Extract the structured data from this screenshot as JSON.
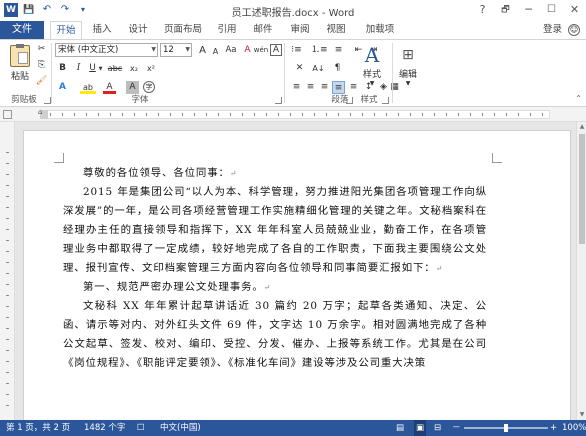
{
  "window": {
    "title": "员工述职报告.docx - Word",
    "controls": {
      "help": "?",
      "restore": "🗗",
      "minimize": "─",
      "maximize": "☐",
      "close": "✕"
    }
  },
  "quick_access": {
    "word_icon": "W",
    "save_icon": "💾",
    "undo_icon": "↶",
    "redo_icon": "↷",
    "customize_icon": "▾"
  },
  "tabs": {
    "file": "文件",
    "items": [
      "开始",
      "插入",
      "设计",
      "页面布局",
      "引用",
      "邮件",
      "审阅",
      "视图",
      "加载项"
    ],
    "active": "开始",
    "login": "登录"
  },
  "ribbon": {
    "clipboard": {
      "paste_label": "粘贴",
      "group_label": "剪贴板"
    },
    "font": {
      "font_name": "宋体 (中文正文)",
      "font_size": "12",
      "group_label": "字体",
      "btn_bold": "B",
      "btn_italic": "I",
      "btn_underline": "U",
      "btn_strike": "abc",
      "btn_sub": "x₂",
      "btn_sup": "x²",
      "btn_grow": "A",
      "btn_shrink": "A",
      "btn_aa": "Aa",
      "btn_clear": "A",
      "btn_wen": "wén",
      "btn_box": "A",
      "btn_effects": "A",
      "btn_highlight": "ab",
      "btn_color": "A",
      "btn_shade": "A",
      "btn_circle": "字"
    },
    "paragraph": {
      "group_label": "段落"
    },
    "styles": {
      "label": "样式",
      "group_label": "样式"
    },
    "editing": {
      "label": "编辑"
    }
  },
  "document": {
    "paragraphs": [
      "尊敬的各位领导、各位同事：",
      "2015 年是集团公司“以人为本、科学管理，努力推进阳光集团各项管理工作向纵深发展”的一年，是公司各项经营管理工作实施精细化管理的关键之年。文秘档案科在经理办主任的直接领导和指挥下，XX 年年科室人员兢兢业业，勤奋工作，在各项管理业务中都取得了一定成绩，较好地完成了各自的工作职责，下面我主要围绕公文处理、报刊宣传、文印档案管理三方面内容向各位领导和同事简要汇报如下：",
      "第一、规范严密办理公文处理事务。",
      "文秘科 XX 年年累计起草讲话近 30 篇约 20 万字；起草各类通知、决定、公函、请示等对内、对外红头文件 69 件，文字达 10 万余字。相对圆满地完成了各种公文起草、签发、校对、编印、受控、分发、催办、上报等系统工作。尤其是在公司《岗位规程》、《职能评定要领》、《标准化车间》建设等涉及公司重大决策"
    ],
    "para_mark": "↵"
  },
  "statusbar": {
    "page": "第 1 页，共 2 页",
    "words": "1482 个字",
    "proof_icon": "☐",
    "language": "中文(中国)",
    "zoom": "100%",
    "zoom_level": 100,
    "zoom_minus": "－",
    "zoom_plus": "+"
  },
  "colors": {
    "accent": "#2b579a",
    "status": "#2b579a"
  }
}
